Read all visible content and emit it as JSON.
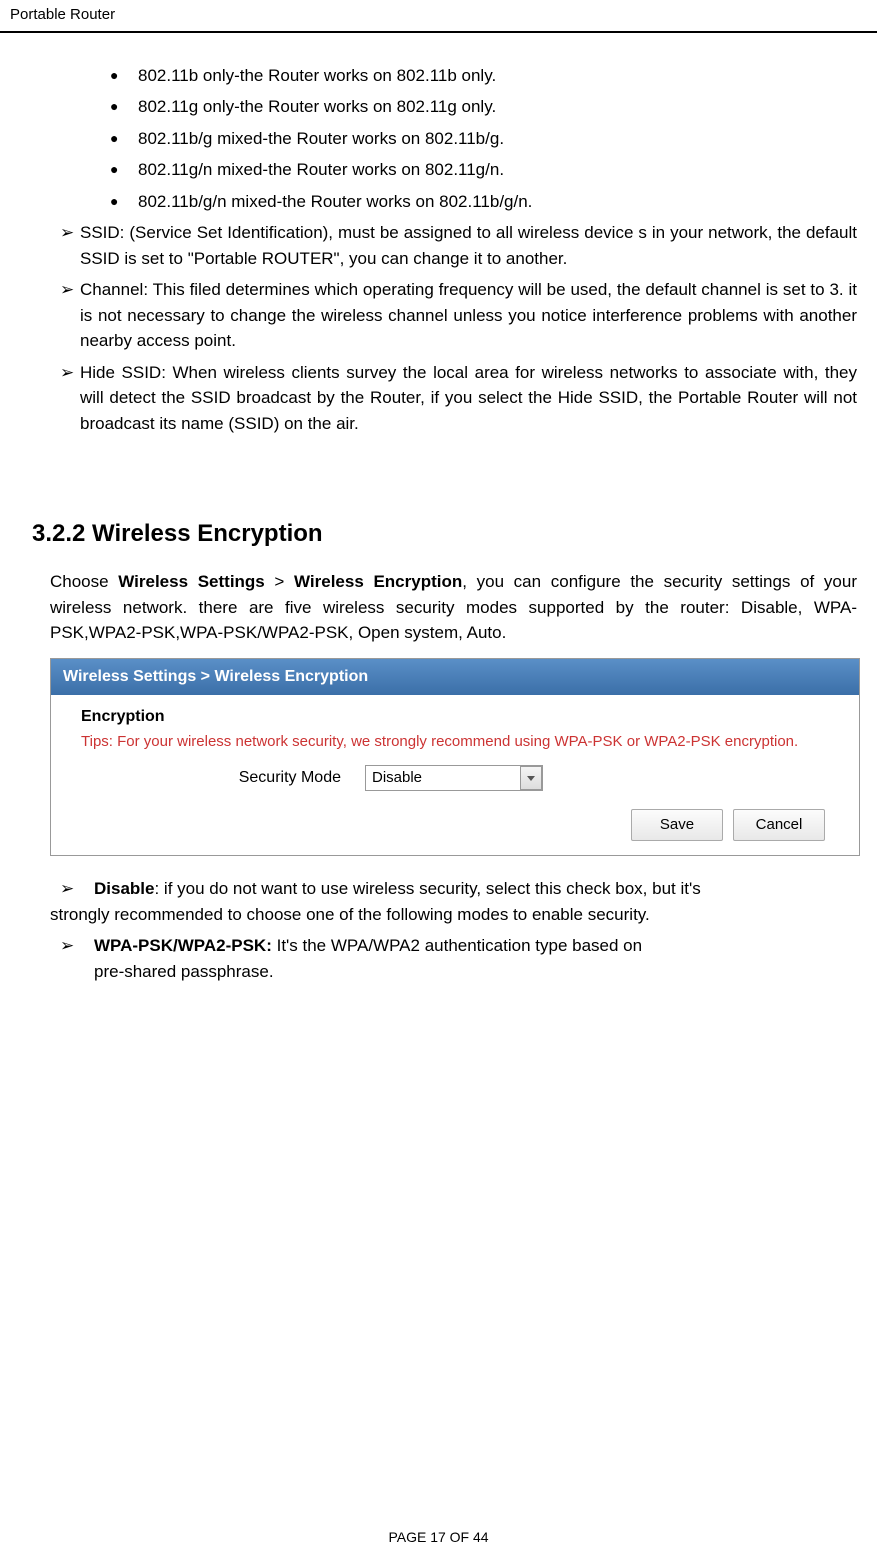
{
  "header": {
    "title": "Portable Router"
  },
  "bullets": [
    "802.11b only-the Router works on 802.11b only.",
    "802.11g only-the Router works on 802.11g only.",
    "802.11b/g mixed-the Router works on 802.11b/g.",
    "802.11g/n mixed-the Router works on 802.11g/n.",
    "802.11b/g/n mixed-the Router works on 802.11b/g/n."
  ],
  "arrows": [
    "SSID: (Service Set Identification), must be assigned to all wireless device s in your network, the default SSID is set to \"Portable ROUTER\", you can change it to another.",
    "Channel: This filed determines which operating frequency will be used, the default channel is set to 3. it is not necessary to change the wireless channel unless you notice interference problems with another nearby access point.",
    "Hide SSID: When wireless clients survey the local area for wireless networks to associate with, they will detect the SSID broadcast by the Router, if you select the Hide SSID, the Portable Router will not broadcast its name (SSID) on the air."
  ],
  "section": {
    "heading": "3.2.2 Wireless Encryption",
    "intro_prefix": "Choose ",
    "intro_bold1": "Wireless Settings",
    "intro_gt": " > ",
    "intro_bold2": "Wireless Encryption",
    "intro_rest": ", you can configure the security settings of your wireless network. there are five wireless security modes supported by the router: Disable, WPA-PSK,WPA2-PSK,WPA-PSK/WPA2-PSK, Open system, Auto."
  },
  "screenshot": {
    "header": "Wireless Settings > Wireless Encryption",
    "encryption_label": "Encryption",
    "tips": "Tips: For your wireless network security, we strongly recommend using WPA-PSK or WPA2-PSK encryption.",
    "security_mode_label": "Security Mode",
    "security_mode_value": "Disable",
    "save_button": "Save",
    "cancel_button": "Cancel"
  },
  "arrows2": {
    "disable_bold": "Disable",
    "disable_text": ": if you do not want to use wireless security, select this check box, but it's",
    "disable_continuation": "strongly recommended to choose one of the following modes to enable security.",
    "wpa_bold": "WPA-PSK/WPA2-PSK: ",
    "wpa_text": "It's the WPA/WPA2 authentication type based on",
    "wpa_line2": "pre-shared passphrase."
  },
  "footer": {
    "text": "PAGE    17    OF    44"
  }
}
